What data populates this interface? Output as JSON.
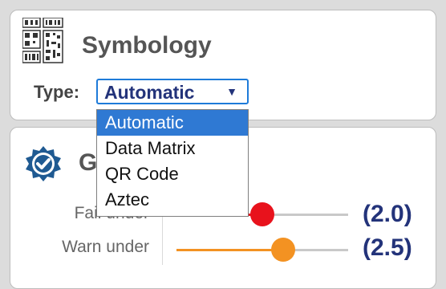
{
  "symbology": {
    "title": "Symbology",
    "icon": "barcode-icon",
    "type_label": "Type:",
    "type_value": "Automatic",
    "options": [
      "Automatic",
      "Data Matrix",
      "QR Code",
      "Aztec"
    ],
    "selected_index": 0
  },
  "grading": {
    "title_visible": "G",
    "icon": "badge-check-icon",
    "fail": {
      "label": "Fail under",
      "value": "(2.0)",
      "level": 0.5,
      "color": "#e8121c"
    },
    "warn": {
      "label": "Warn under",
      "value": "(2.5)",
      "level": 0.62,
      "color": "#f39222"
    }
  },
  "colors": {
    "accent": "#1e7bd9",
    "value_text": "#23337a",
    "dropdown_selected_bg": "#2f79d3"
  }
}
